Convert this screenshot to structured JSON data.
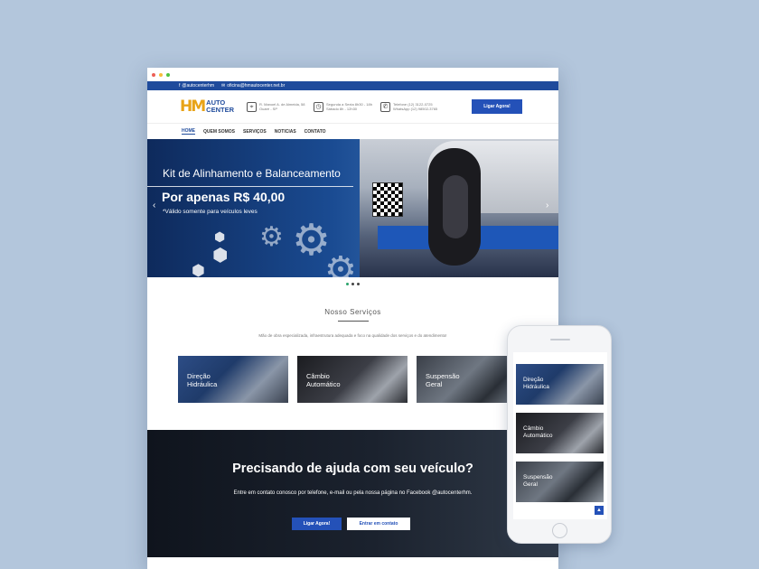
{
  "topbar": {
    "facebook_icon": "f",
    "facebook_handle": "@autocenterhm",
    "email_icon": "envelope-icon",
    "email": "oficina@hmautocenter.net.br"
  },
  "logo": {
    "mark": "HM",
    "line1": "AUTO",
    "line2": "CENTER"
  },
  "info": {
    "address": "R. Manoel A. de Almeida, 58 Ouaré - SP",
    "hours": "Segunda a Sexta 8h30 - 18h Sábado 8h - 12h30",
    "phone": "Telefone (12) 3122-0725 WhatsApp (12) 98502-3765"
  },
  "header_cta": "Ligar Agora!",
  "nav": [
    "HOME",
    "QUEM SOMOS",
    "SERVIÇOS",
    "NOTICIAS",
    "CONTATO"
  ],
  "hero": {
    "title": "Kit de Alinhamento e Balanceamento",
    "price": "Por apenas R$ 40,00",
    "note": "*Válido somente para veículos leves",
    "prev_icon": "‹",
    "next_icon": "›"
  },
  "services": {
    "title": "Nosso Serviços",
    "subtitle": "Mão de obra especializada, infraestrutura adequada e foco na qualidade dos serviços e do atendimento!",
    "cards": [
      {
        "line1": "Direção",
        "line2": "Hidráulica"
      },
      {
        "line1": "Câmbio",
        "line2": "Automático"
      },
      {
        "line1": "Suspensão",
        "line2": "Geral"
      }
    ]
  },
  "cta_section": {
    "heading": "Precisando de ajuda com seu veículo?",
    "text": "Entre em contato conosco por telefone, e-mail ou pela nossa página no Facebook @autocenterhm.",
    "button_call": "Ligar Agora!",
    "button_contact": "Entrar em contato"
  },
  "phone": {
    "cards": [
      {
        "line1": "Direção",
        "line2": "Hidráulica"
      },
      {
        "line1": "Câmbio",
        "line2": "Automático"
      },
      {
        "line1": "Suspensão",
        "line2": "Geral"
      }
    ],
    "back_to_top_icon": "▲"
  },
  "colors": {
    "background": "#b3c6dc",
    "brand_blue": "#1f4b9c",
    "button_blue": "#2451b8",
    "logo_orange": "#e8a317",
    "active_dot": "#2aa36b"
  }
}
